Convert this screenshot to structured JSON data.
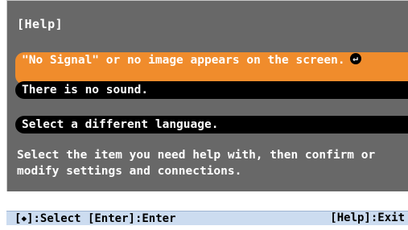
{
  "help": {
    "title": "[Help]",
    "items": [
      {
        "label": "\"No Signal\" or no image appears on the screen.",
        "selected": true,
        "icon": "enter-arrow-icon"
      },
      {
        "label": "There is no sound.",
        "selected": false
      },
      {
        "label": "Select a different language.",
        "selected": false
      }
    ],
    "message": "Select the item you need help with, then confirm or modify settings and connections."
  },
  "statusbar": {
    "select_key": "◆",
    "select_label": "]:Select",
    "enter_label": "[Enter]:Enter",
    "exit_label": "[Help]:Exit"
  },
  "colors": {
    "panel": "#686868",
    "selected": "#f08c2c",
    "item": "#000000",
    "statusbar": "#ccdcf0"
  }
}
